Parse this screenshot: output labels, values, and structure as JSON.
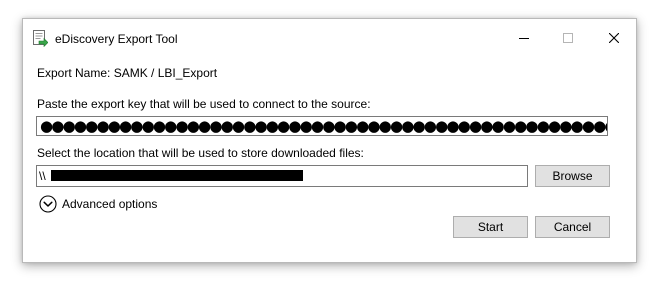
{
  "window": {
    "title": "eDiscovery Export Tool",
    "controls": {
      "minimize_icon": "minimize-icon",
      "maximize_icon": "maximize-icon",
      "close_icon": "close-icon"
    }
  },
  "export": {
    "name_label": "Export Name: SAMK / LBI_Export",
    "key_label": "Paste the export key that will be used to connect to the source:",
    "key_value": "●●●●●●●●●●●●●●●●●●●●●●●●●●●●●●●●●●●●●●●●●●●●●●●●●●●●●●●●●●●●●●●●●●●●●●●●●●●●●●●●●●●●●●●●●●●●●●●●●●●●●●●●●●●●●●●●●●●●●●●●●●●●●●●●●●●●●●●●●●●●●●●●●●●●●●●●●",
    "location_label": "Select the location that will be used to store downloaded files:",
    "location_value": "\\\\",
    "location_redacted": true
  },
  "buttons": {
    "browse": "Browse",
    "start": "Start",
    "cancel": "Cancel"
  },
  "advanced": {
    "label": "Advanced options",
    "icon": "chevron-down-circle-icon"
  }
}
